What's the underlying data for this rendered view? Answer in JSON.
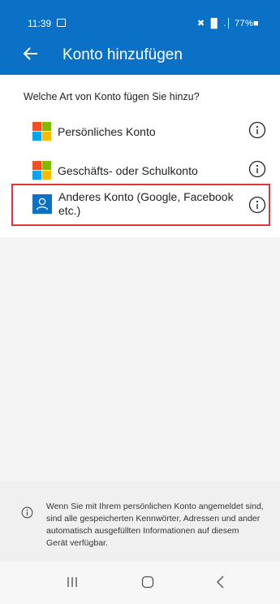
{
  "status_bar": {
    "time": "11:39",
    "right_text": "✖︎ ▐▌ .│ 77%■",
    "image_icon": "image-icon"
  },
  "header": {
    "title": "Konto hinzufügen",
    "back_icon": "arrow-left-icon",
    "background": "#0a71c6"
  },
  "question": "Welche Art von Konto fügen Sie hinzu?",
  "accounts": [
    {
      "label": "Persönliches Konto",
      "icon": "microsoft-logo",
      "info_icon": "info-icon"
    },
    {
      "label": "Geschäfts- oder Schulkonto",
      "icon": "microsoft-logo",
      "info_icon": "info-icon"
    },
    {
      "label": "Anderes Konto (Google, Facebook etc.)",
      "icon": "person-icon",
      "info_icon": "info-icon",
      "highlight_color": "#e0343f"
    }
  ],
  "footer": {
    "text": "Wenn Sie mit Ihrem persönlichen Konto angemeldet sind,\nsind alle gespeicherten Kennwörter, Adressen und ander\nautomatisch ausgefüllten Informationen auf diesem\nGerät verfügbar.",
    "icon": "info-icon"
  },
  "nav": {
    "recent": "recent-apps-icon",
    "home": "home-icon",
    "back": "back-icon"
  }
}
